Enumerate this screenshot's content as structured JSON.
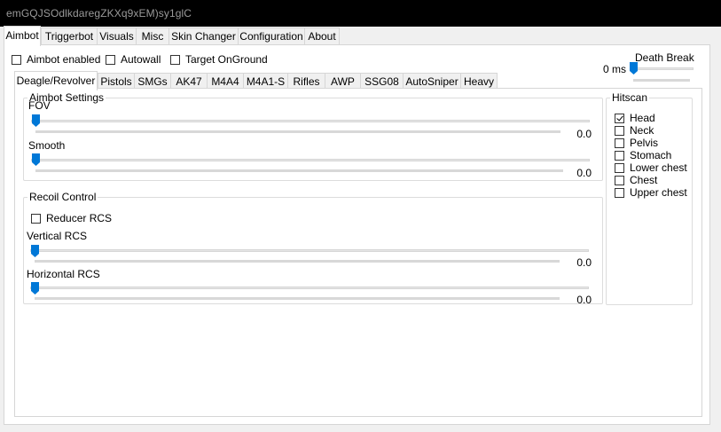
{
  "window": {
    "title": "emGQJSOdlkdaregZKXq9xEM)sy1glC"
  },
  "main_tabs": [
    {
      "label": "Aimbot",
      "active": true
    },
    {
      "label": "Triggerbot",
      "active": false
    },
    {
      "label": "Visuals",
      "active": false
    },
    {
      "label": "Misc",
      "active": false
    },
    {
      "label": "Skin Changer",
      "active": false
    },
    {
      "label": "Configuration",
      "active": false
    },
    {
      "label": "About",
      "active": false
    }
  ],
  "top_options": {
    "aimbot_enabled": {
      "label": "Aimbot enabled",
      "checked": false
    },
    "autowall": {
      "label": "Autowall",
      "checked": false
    },
    "target_onground": {
      "label": "Target OnGround",
      "checked": false
    }
  },
  "death_break": {
    "label": "Death Break",
    "value": "0 ms",
    "level": 0
  },
  "weapon_tabs": [
    {
      "label": "Deagle/Revolver",
      "active": true
    },
    {
      "label": "Pistols",
      "active": false
    },
    {
      "label": "SMGs",
      "active": false
    },
    {
      "label": "AK47",
      "active": false
    },
    {
      "label": "M4A4",
      "active": false
    },
    {
      "label": "M4A1-S",
      "active": false
    },
    {
      "label": "Rifles",
      "active": false
    },
    {
      "label": "AWP",
      "active": false
    },
    {
      "label": "SSG08",
      "active": false
    },
    {
      "label": "AutoSniper",
      "active": false
    },
    {
      "label": "Heavy",
      "active": false
    }
  ],
  "aimbot_settings": {
    "title": "Aimbot Settings",
    "fov": {
      "label": "FOV",
      "value": "0.0",
      "level": 0
    },
    "smooth": {
      "label": "Smooth",
      "value": "0.0",
      "level": 0
    }
  },
  "recoil_control": {
    "title": "Recoil Control",
    "reducer_rcs": {
      "label": "Reducer RCS",
      "checked": false
    },
    "vertical": {
      "label": "Vertical RCS",
      "value": "0.0",
      "level": 0
    },
    "horizontal": {
      "label": "Horizontal RCS",
      "value": "0.0",
      "level": 0
    }
  },
  "hitscan": {
    "title": "Hitscan",
    "items": [
      {
        "label": "Head",
        "checked": true
      },
      {
        "label": "Neck",
        "checked": false
      },
      {
        "label": "Pelvis",
        "checked": false
      },
      {
        "label": "Stomach",
        "checked": false
      },
      {
        "label": "Lower chest",
        "checked": false
      },
      {
        "label": "Chest",
        "checked": false
      },
      {
        "label": "Upper chest",
        "checked": false
      }
    ]
  },
  "colors": {
    "accent": "#0078d7",
    "titlebar": "#000000",
    "title_text": "#9a9a9a"
  }
}
